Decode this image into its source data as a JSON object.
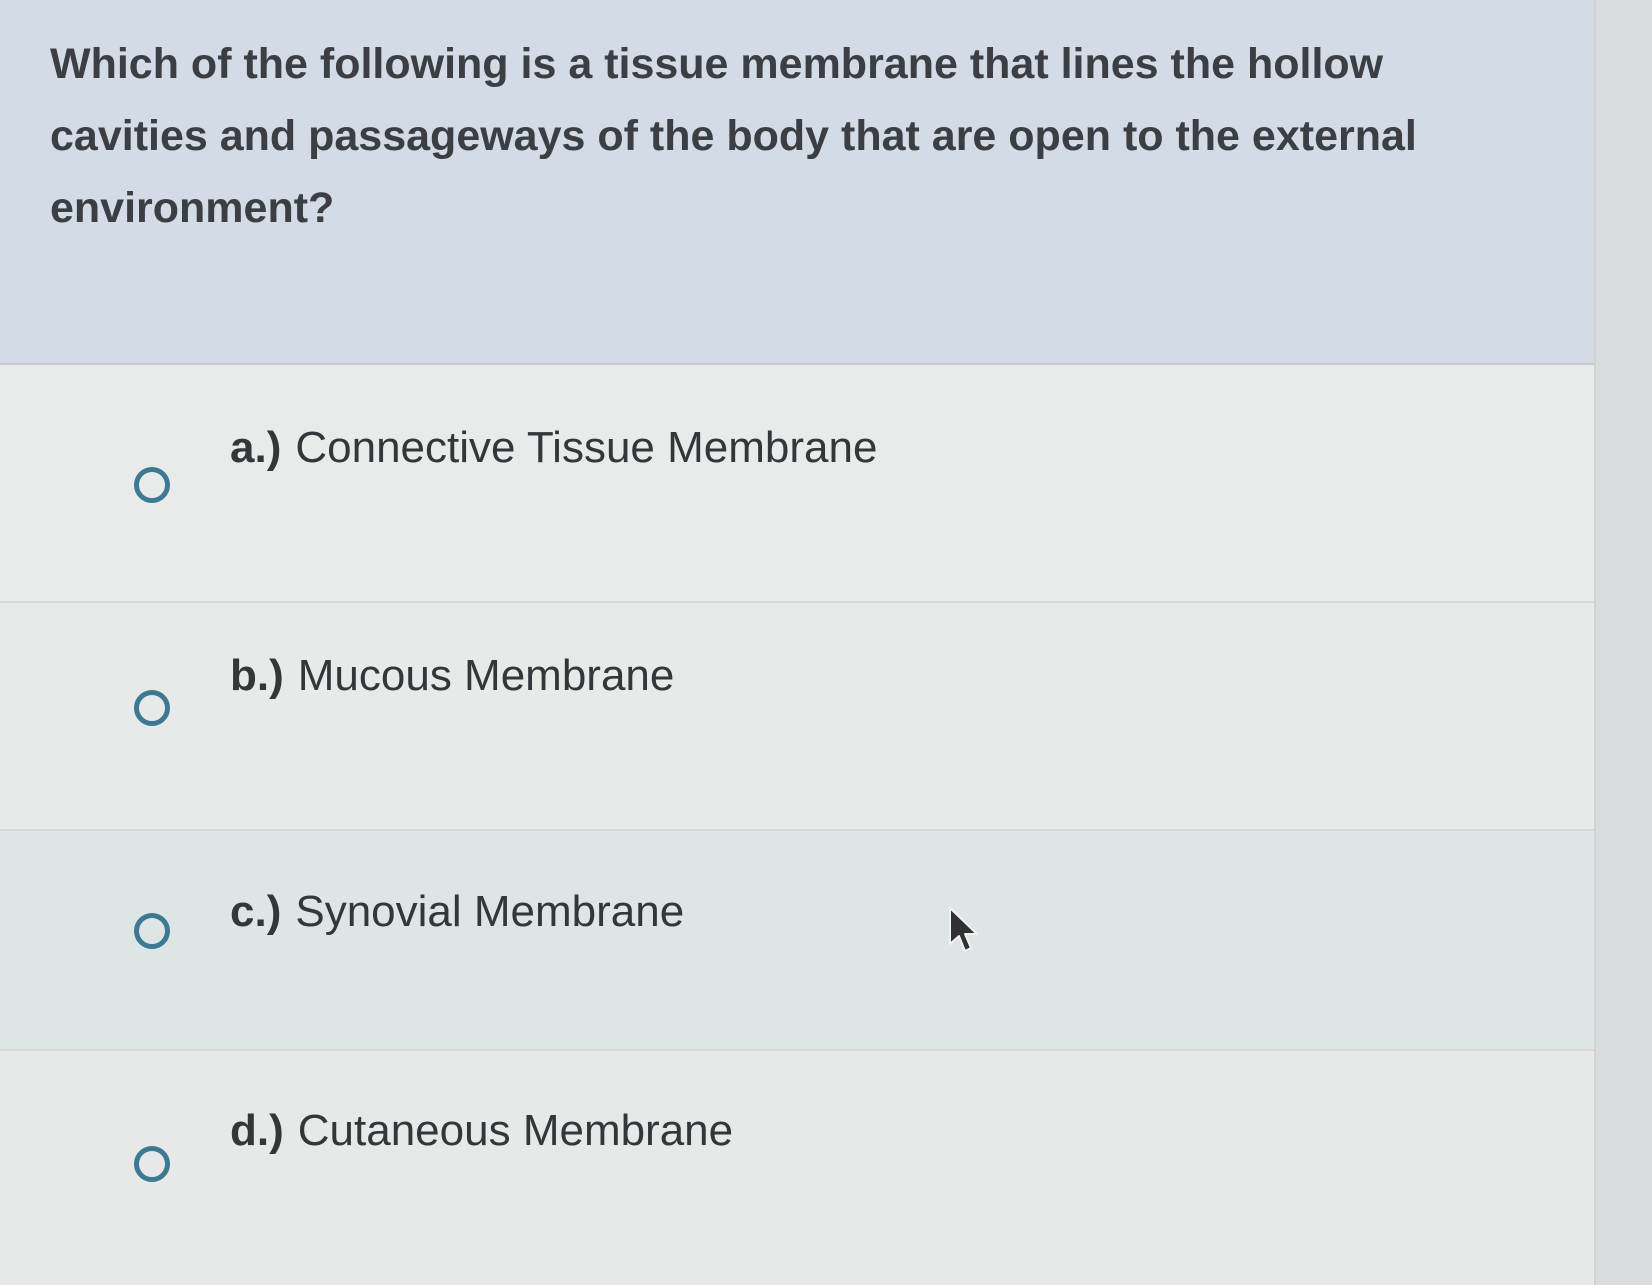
{
  "question": {
    "text": "Which of the following is a tissue membrane that lines the hollow cavities and passageways of the body that are open to the external environment?"
  },
  "choices": [
    {
      "letter": "a.)",
      "text": "Connective Tissue Membrane",
      "selected": false
    },
    {
      "letter": "b.)",
      "text": "Mucous Membrane",
      "selected": false
    },
    {
      "letter": "c.)",
      "text": "Synovial Membrane",
      "selected": false
    },
    {
      "letter": "d.)",
      "text": "Cutaneous Membrane",
      "selected": false
    }
  ],
  "colors": {
    "question_background": "#d3dbe6",
    "radio_accent": "#3e7993",
    "text": "#33373a"
  },
  "icons": {
    "radio": "radio-unchecked-icon",
    "cursor": "mouse-pointer-icon"
  }
}
